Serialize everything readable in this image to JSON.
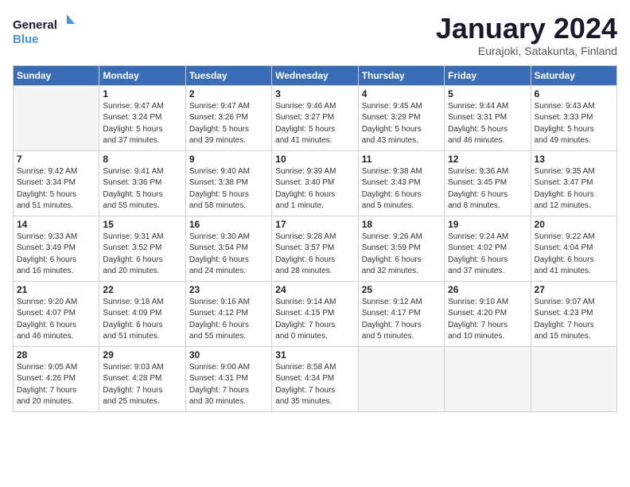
{
  "header": {
    "logo_general": "General",
    "logo_blue": "Blue",
    "month_title": "January 2024",
    "subtitle": "Eurajoki, Satakunta, Finland"
  },
  "days_of_week": [
    "Sunday",
    "Monday",
    "Tuesday",
    "Wednesday",
    "Thursday",
    "Friday",
    "Saturday"
  ],
  "weeks": [
    [
      {
        "num": "",
        "info": ""
      },
      {
        "num": "1",
        "info": "Sunrise: 9:47 AM\nSunset: 3:24 PM\nDaylight: 5 hours\nand 37 minutes."
      },
      {
        "num": "2",
        "info": "Sunrise: 9:47 AM\nSunset: 3:26 PM\nDaylight: 5 hours\nand 39 minutes."
      },
      {
        "num": "3",
        "info": "Sunrise: 9:46 AM\nSunset: 3:27 PM\nDaylight: 5 hours\nand 41 minutes."
      },
      {
        "num": "4",
        "info": "Sunrise: 9:45 AM\nSunset: 3:29 PM\nDaylight: 5 hours\nand 43 minutes."
      },
      {
        "num": "5",
        "info": "Sunrise: 9:44 AM\nSunset: 3:31 PM\nDaylight: 5 hours\nand 46 minutes."
      },
      {
        "num": "6",
        "info": "Sunrise: 9:43 AM\nSunset: 3:33 PM\nDaylight: 5 hours\nand 49 minutes."
      }
    ],
    [
      {
        "num": "7",
        "info": "Sunrise: 9:42 AM\nSunset: 3:34 PM\nDaylight: 5 hours\nand 51 minutes."
      },
      {
        "num": "8",
        "info": "Sunrise: 9:41 AM\nSunset: 3:36 PM\nDaylight: 5 hours\nand 55 minutes."
      },
      {
        "num": "9",
        "info": "Sunrise: 9:40 AM\nSunset: 3:38 PM\nDaylight: 5 hours\nand 58 minutes."
      },
      {
        "num": "10",
        "info": "Sunrise: 9:39 AM\nSunset: 3:40 PM\nDaylight: 6 hours\nand 1 minute."
      },
      {
        "num": "11",
        "info": "Sunrise: 9:38 AM\nSunset: 3:43 PM\nDaylight: 6 hours\nand 5 minutes."
      },
      {
        "num": "12",
        "info": "Sunrise: 9:36 AM\nSunset: 3:45 PM\nDaylight: 6 hours\nand 8 minutes."
      },
      {
        "num": "13",
        "info": "Sunrise: 9:35 AM\nSunset: 3:47 PM\nDaylight: 6 hours\nand 12 minutes."
      }
    ],
    [
      {
        "num": "14",
        "info": "Sunrise: 9:33 AM\nSunset: 3:49 PM\nDaylight: 6 hours\nand 16 minutes."
      },
      {
        "num": "15",
        "info": "Sunrise: 9:31 AM\nSunset: 3:52 PM\nDaylight: 6 hours\nand 20 minutes."
      },
      {
        "num": "16",
        "info": "Sunrise: 9:30 AM\nSunset: 3:54 PM\nDaylight: 6 hours\nand 24 minutes."
      },
      {
        "num": "17",
        "info": "Sunrise: 9:28 AM\nSunset: 3:57 PM\nDaylight: 6 hours\nand 28 minutes."
      },
      {
        "num": "18",
        "info": "Sunrise: 9:26 AM\nSunset: 3:59 PM\nDaylight: 6 hours\nand 32 minutes."
      },
      {
        "num": "19",
        "info": "Sunrise: 9:24 AM\nSunset: 4:02 PM\nDaylight: 6 hours\nand 37 minutes."
      },
      {
        "num": "20",
        "info": "Sunrise: 9:22 AM\nSunset: 4:04 PM\nDaylight: 6 hours\nand 41 minutes."
      }
    ],
    [
      {
        "num": "21",
        "info": "Sunrise: 9:20 AM\nSunset: 4:07 PM\nDaylight: 6 hours\nand 46 minutes."
      },
      {
        "num": "22",
        "info": "Sunrise: 9:18 AM\nSunset: 4:09 PM\nDaylight: 6 hours\nand 51 minutes."
      },
      {
        "num": "23",
        "info": "Sunrise: 9:16 AM\nSunset: 4:12 PM\nDaylight: 6 hours\nand 55 minutes."
      },
      {
        "num": "24",
        "info": "Sunrise: 9:14 AM\nSunset: 4:15 PM\nDaylight: 7 hours\nand 0 minutes."
      },
      {
        "num": "25",
        "info": "Sunrise: 9:12 AM\nSunset: 4:17 PM\nDaylight: 7 hours\nand 5 minutes."
      },
      {
        "num": "26",
        "info": "Sunrise: 9:10 AM\nSunset: 4:20 PM\nDaylight: 7 hours\nand 10 minutes."
      },
      {
        "num": "27",
        "info": "Sunrise: 9:07 AM\nSunset: 4:23 PM\nDaylight: 7 hours\nand 15 minutes."
      }
    ],
    [
      {
        "num": "28",
        "info": "Sunrise: 9:05 AM\nSunset: 4:26 PM\nDaylight: 7 hours\nand 20 minutes."
      },
      {
        "num": "29",
        "info": "Sunrise: 9:03 AM\nSunset: 4:28 PM\nDaylight: 7 hours\nand 25 minutes."
      },
      {
        "num": "30",
        "info": "Sunrise: 9:00 AM\nSunset: 4:31 PM\nDaylight: 7 hours\nand 30 minutes."
      },
      {
        "num": "31",
        "info": "Sunrise: 8:58 AM\nSunset: 4:34 PM\nDaylight: 7 hours\nand 35 minutes."
      },
      {
        "num": "",
        "info": ""
      },
      {
        "num": "",
        "info": ""
      },
      {
        "num": "",
        "info": ""
      }
    ]
  ]
}
